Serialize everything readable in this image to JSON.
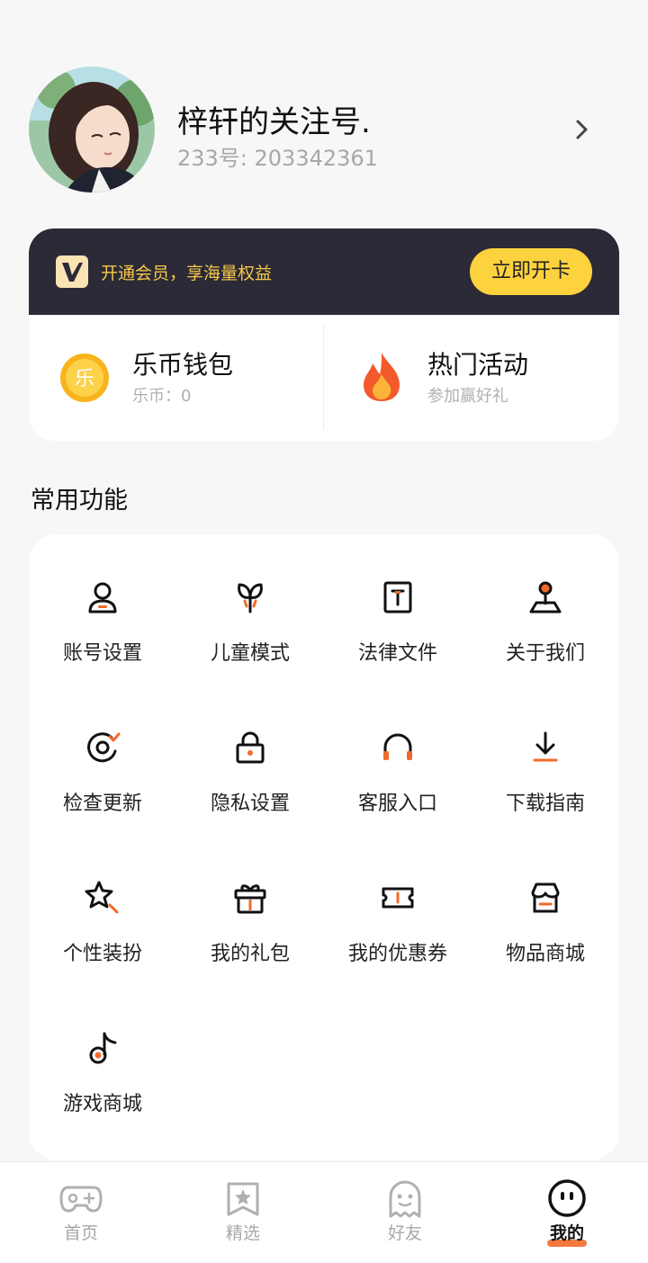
{
  "profile": {
    "name": "梓轩的关注号.",
    "uid": "233号: 203342361"
  },
  "vip": {
    "text": "开通会员，享海量权益",
    "button": "立即开卡"
  },
  "wallet": {
    "title": "乐币钱包",
    "sub": "乐币：0"
  },
  "hot": {
    "title": "热门活动",
    "sub": "参加赢好礼"
  },
  "section_title": "常用功能",
  "features": [
    {
      "label": "账号设置",
      "icon": "account-icon"
    },
    {
      "label": "儿童模式",
      "icon": "sprout-icon"
    },
    {
      "label": "法律文件",
      "icon": "document-icon"
    },
    {
      "label": "关于我们",
      "icon": "joystick-icon"
    },
    {
      "label": "检查更新",
      "icon": "update-icon"
    },
    {
      "label": "隐私设置",
      "icon": "lock-icon"
    },
    {
      "label": "客服入口",
      "icon": "headset-icon"
    },
    {
      "label": "下载指南",
      "icon": "download-icon"
    },
    {
      "label": "个性装扮",
      "icon": "star-wand-icon"
    },
    {
      "label": "我的礼包",
      "icon": "gift-icon"
    },
    {
      "label": "我的优惠券",
      "icon": "coupon-icon"
    },
    {
      "label": "物品商城",
      "icon": "shop-icon"
    },
    {
      "label": "游戏商城",
      "icon": "music-note-icon"
    }
  ],
  "tabs": [
    {
      "label": "首页",
      "icon": "gamepad-icon"
    },
    {
      "label": "精选",
      "icon": "star-badge-icon"
    },
    {
      "label": "好友",
      "icon": "ghost-icon"
    },
    {
      "label": "我的",
      "icon": "smiley-icon"
    }
  ],
  "colors": {
    "accent": "#fdd23f",
    "orange": "#f26a2a",
    "vip_bg": "#2b2a36",
    "vip_text": "#f7c84a"
  }
}
